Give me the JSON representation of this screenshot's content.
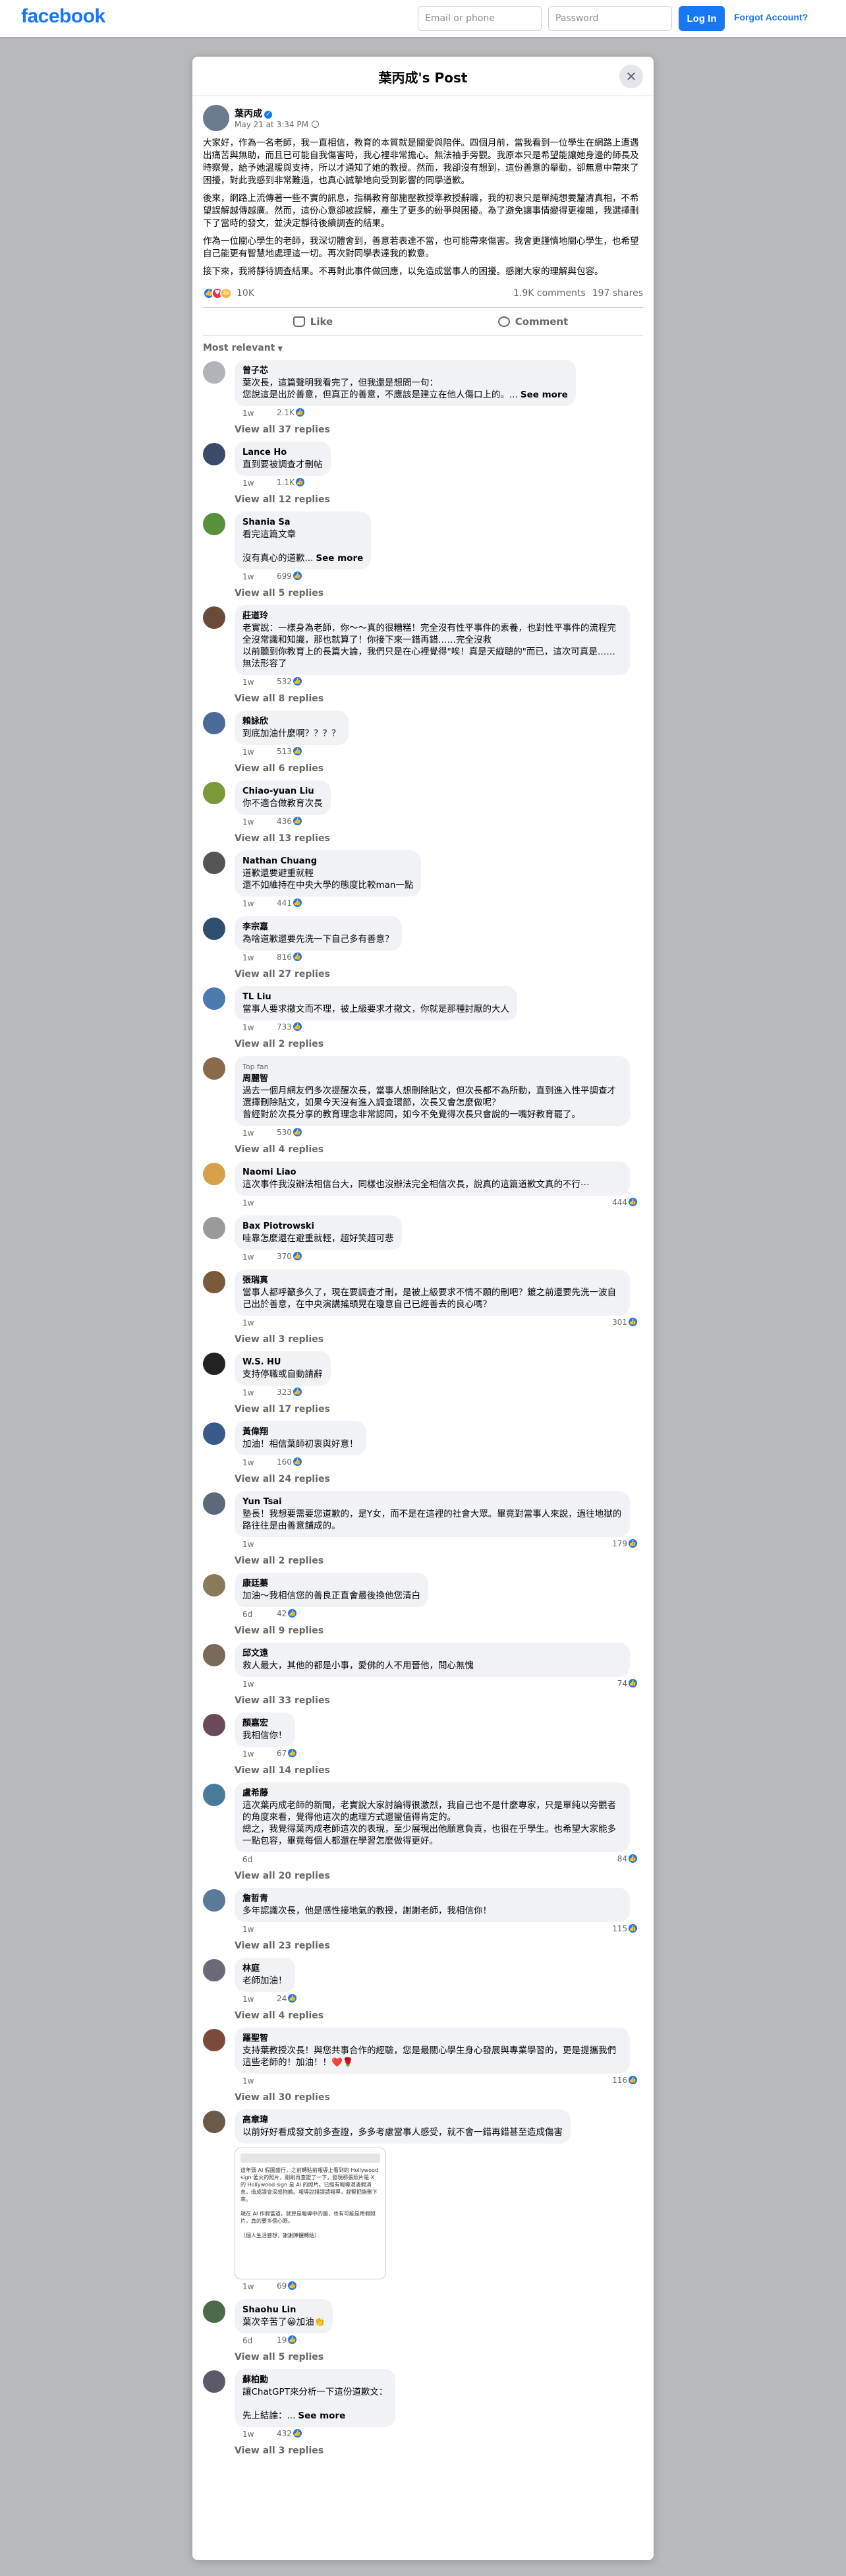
{
  "nav": {
    "logo": "facebook",
    "email_placeholder": "Email or phone",
    "password_placeholder": "Password",
    "login_label": "Log In",
    "forgot_label": "Forgot Account?"
  },
  "dialog": {
    "title": "葉丙成's Post",
    "close_icon": "close-icon"
  },
  "post": {
    "author": "葉丙成",
    "timestamp": "May 21 at 3:34 PM",
    "paragraphs": [
      "大家好，作為一名老師，我一直相信，教育的本質就是關愛與陪伴。四個月前，當我看到一位學生在網路上遭遇出痛苦與無助，而且已可能自我傷害時，我心裡非常擔心。無法袖手旁觀。我原本只是希望能讓她身邊的師長及時察覺，給予她溫暖與支持，所以才通知了她的教授。然而，我卻沒有想到，這份善意的舉動，卻無意中帶來了困擾，對此我感到非常難過，也真心誠摯地向受到影響的同學道歉。",
      "後來，網路上流傳著一些不實的訊息，指稱教育部施壓教授準教授辭職，我的初衷只是單純想要釐清真相，不希望誤解越傳越廣。然而，這份心意卻被誤解，產生了更多的紛爭與困擾。為了避免讓事情變得更複雜，我選擇刪下了當時的發文，並決定靜待後續調查的結果。",
      "作為一位關心學生的老師，我深切體會到，善意若表達不當，也可能帶來傷害。我會更謹慎地關心學生，也希望自己能更有智慧地處理這一切。再次對同學表達我的歉意。",
      "接下來，我將靜待調查結果。不再對此事件做回應，以免造成當事人的困擾。感謝大家的理解與包容。"
    ],
    "reaction_count": "10K",
    "comments_count": "1.9K comments",
    "shares_count": "197 shares",
    "like_label": "Like",
    "comment_label": "Comment",
    "sort_label": "Most relevant"
  },
  "comments": [
    {
      "name": "曾子芯",
      "text": "葉次長，這篇聲明我看完了，但我還是想問一句：\n您說這是出於善意，但真正的善意，不應該是建立在他人傷口上的。...",
      "see_more": "See more",
      "time": "1w",
      "reactions": "2.1K",
      "replies": "View all 37 replies",
      "avatar_color": "#b0b3b8"
    },
    {
      "name": "Lance Ho",
      "text": "直到要被調查才刪帖",
      "time": "1w",
      "reactions": "1.1K",
      "replies": "View all 12 replies",
      "avatar_color": "#3b4a6b"
    },
    {
      "name": "Shania Sa",
      "text": "看完這篇文章\n\n沒有真心的道歉...",
      "see_more": "See more",
      "time": "1w",
      "reactions": "699",
      "replies": "View all 5 replies",
      "avatar_color": "#5a8f3c"
    },
    {
      "name": "莊道玲",
      "text": "老實說：一樣身為老師，你〜〜真的很糟糕！完全沒有性平事件的素養，也對性平事件的流程完全沒常識和知識，那也就算了！你接下來一錯再錯……完全沒救\n以前聽到你教育上的長篇大論，我們只是在心裡覺得\"唉！真是天縱聰的\"而已，這次可真是……無法形容了",
      "time": "1w",
      "reactions": "532",
      "replies": "View all 8 replies",
      "avatar_color": "#6b4a3a"
    },
    {
      "name": "賴詠欣",
      "text": "到底加油什麼啊？？？？",
      "time": "1w",
      "reactions": "513",
      "replies": "View all 6 replies",
      "avatar_color": "#4a6a9a"
    },
    {
      "name": "Chiao-yuan Liu",
      "text": "你不適合做教育次長",
      "time": "1w",
      "reactions": "436",
      "replies": "View all 13 replies",
      "avatar_color": "#7a9a3a"
    },
    {
      "name": "Nathan Chuang",
      "text": "道歉還要避重就輕\n還不如維持在中央大學的態度比較man一點",
      "time": "1w",
      "reactions": "441",
      "replies": "",
      "avatar_color": "#555555"
    },
    {
      "name": "李宗嘉",
      "text": "為啥道歉還要先洗一下自己多有善意？",
      "time": "1w",
      "reactions": "816",
      "replies": "View all 27 replies",
      "avatar_color": "#2f4f6f"
    },
    {
      "name": "TL Liu",
      "text": "當事人要求撤文而不理，被上級要求才撤文，你就是那種討厭的大人",
      "time": "1w",
      "reactions": "733",
      "replies": "View all 2 replies",
      "avatar_color": "#4a7ab0"
    },
    {
      "name": "周麗智",
      "top_fan": "Top fan",
      "text": "過去一個月網友們多次提醒次長，當事人想刪除貼文，但次長都不為所動，直到進入性平調查才選擇刪除貼文，如果今天沒有進入調查環節，次長又會怎麼做呢？\n曾經對於次長分享的教育理念非常認同，如今不免覺得次長只會說的一嘴好教育罷了。",
      "time": "1w",
      "reactions": "530",
      "replies": "View all 4 replies",
      "avatar_color": "#8a6a4a"
    },
    {
      "name": "Naomi Liao",
      "text": "這次事件我沒辦法相信台大，同樣也沒辦法完全相信次長，說真的這篇道歉文真的不行⋯",
      "time": "1w",
      "reactions": "444",
      "replies": "",
      "avatar_color": "#d6a14a",
      "right_count": true
    },
    {
      "name": "Bax Piotrowski",
      "text": "哇靠怎麼還在避重就輕，超好笑超可悲",
      "time": "1w",
      "reactions": "370",
      "replies": "",
      "avatar_color": "#9a9a9a"
    },
    {
      "name": "張瑞真",
      "text": "當事人都呼籲多久了，現在要調查才刪，是被上級要求不情不願的刪吧？鍍之前還要先洗一波自己出於善意，在中央演講搖頭晃在瓊意自己已經善去的良心嗎？",
      "time": "1w",
      "reactions": "301",
      "replies": "View all 3 replies",
      "avatar_color": "#7a5a3a",
      "right_count": true
    },
    {
      "name": "W.S. HU",
      "text": "支持停職或自動請辭",
      "time": "1w",
      "reactions": "323",
      "replies": "View all 17 replies",
      "avatar_color": "#222222"
    },
    {
      "name": "黃偉翔",
      "text": "加油！相信葉師初衷與好意！",
      "time": "1w",
      "reactions": "160",
      "replies": "View all 24 replies",
      "avatar_color": "#3a5a8a"
    },
    {
      "name": "Yun Tsai",
      "text": "塾長！我想要需要您道歉的，是Y女，而不是在這裡的社會大眾。畢竟對當事人來說，過往地獄的路往往是由善意舖成的。",
      "time": "1w",
      "reactions": "179",
      "replies": "View all 2 replies",
      "avatar_color": "#5a6a7a",
      "right_count": true
    },
    {
      "name": "康廷蓁",
      "text": "加油〜我相信您的善良正直會最後換他您清白",
      "time": "6d",
      "reactions": "42",
      "replies": "View all 9 replies",
      "avatar_color": "#8a7a5a"
    },
    {
      "name": "邱文遠",
      "text": "救人最大，其他的都是小事，愛佛的人不用晉他，問心無愧",
      "time": "1w",
      "reactions": "74",
      "replies": "View all 33 replies",
      "avatar_color": "#7a6a5a",
      "right_count": true
    },
    {
      "name": "顏嘉宏",
      "text": "我相信你！",
      "time": "1w",
      "reactions": "67",
      "replies": "View all 14 replies",
      "avatar_color": "#6a4a5a"
    },
    {
      "name": "盧希藤",
      "text": "這次葉丙成老師的新聞，老實說大家討論得很激烈，我自己也不是什麼專家，只是單純以旁觀者的角度來看，覺得他這次的處理方式還蠻值得肯定的。\n總之，我覺得葉丙成老師這次的表現，至少展現出他願意負責，也很在乎學生。也希望大家能多一點包容，畢竟每個人都還在學習怎麼做得更好。",
      "time": "6d",
      "reactions": "84",
      "replies": "View all 20 replies",
      "avatar_color": "#4a7a9a",
      "right_count": true
    },
    {
      "name": "詹哲青",
      "text": "多年認識次長，他是感性接地氣的教授，謝謝老師，我相信你！",
      "time": "1w",
      "reactions": "115",
      "replies": "View all 23 replies",
      "avatar_color": "#5a7a9a",
      "right_count": true
    },
    {
      "name": "林庭",
      "text": "老師加油！",
      "time": "1w",
      "reactions": "24",
      "replies": "View all 4 replies",
      "avatar_color": "#6a6a7a"
    },
    {
      "name": "羅聖智",
      "text": "支持葉教授次長！與您共事合作的經驗，您是最關心學生身心發展與專業學習的，更是提攜我們這些老師的！加油！！❤️🌹",
      "time": "1w",
      "reactions": "116",
      "replies": "View all 30 replies",
      "avatar_color": "#7a4a3a",
      "right_count": true
    },
    {
      "name": "高章瑋",
      "text": "以前好好看成發文前多查證，多多考慮當事人感受，就不會一錯再錯甚至造成傷害",
      "time": "1w",
      "reactions": "69",
      "replies": "",
      "avatar_color": "#6a5a4a",
      "embed": "這年頭 AI 假圖盛行，之前轉貼前報導上看到的 Hollywood sign 著火的照片，剛剛再查證了一下，發現那張照片是 X 的 Hollywood sign 是 AI 的照片。已經有報導澄清假消息，造成誤會深感抱歉。報導說錯誤請報導，趕緊把錯刪下來。\n\n現在 AI 作假當道，就算是報導中的圖，也有可能是用假照片，真的要多個心眼。\n\n（個人生活感想，謝謝陳體轉貼）"
    },
    {
      "name": "Shaohu Lin",
      "text": "葉次辛苦了😀加油👏",
      "time": "6d",
      "reactions": "19",
      "replies": "View all 5 replies",
      "avatar_color": "#4a6a4a"
    },
    {
      "name": "蘇柏勳",
      "text": "讓ChatGPT來分析一下這份道歉文：\n\n先上結論：...",
      "see_more": "See more",
      "time": "1w",
      "reactions": "432",
      "replies": "View all 3 replies",
      "avatar_color": "#5a5a6a"
    }
  ]
}
